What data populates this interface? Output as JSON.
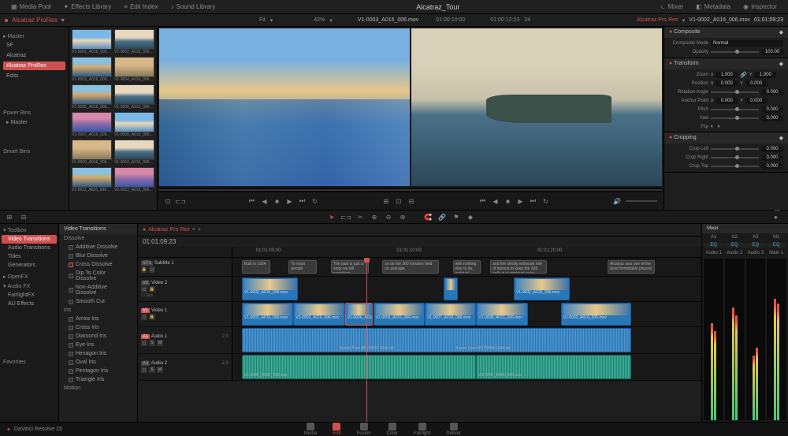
{
  "project_title": "Alcatraz_Tour",
  "top_tabs": {
    "media_pool": "Media Pool",
    "effects": "Effects Library",
    "edit_index": "Edit Index",
    "sound": "Sound Library",
    "mixer": "Mixer",
    "metadata": "Metadata",
    "inspector": "Inspector"
  },
  "sub_bar": {
    "left_label": "Alcatraz ProRes",
    "fit": "Fit",
    "zoom_pct": "42%",
    "src_name": "V1-0003_A016_006.mov",
    "src_tc": "01:00:10:00",
    "dur": "01:00:12:23",
    "fps": "24",
    "right_label": "Alcatraz Pro Rez",
    "right_name": "V1-0002_A016_006.mov",
    "right_tc": "01:01:09:23"
  },
  "bins": {
    "master": "Master",
    "items": [
      "SF",
      "Alcatraz",
      "Alcatraz ProRes",
      "Edits"
    ],
    "sel": 2,
    "power": "Power Bins",
    "pb": "Master",
    "smart": "Smart Bins"
  },
  "thumbs": [
    "V1-0001_A016_006...",
    "V1-0002_A016_006...",
    "V1-0003_A016_006...",
    "V1-0004_A016_006...",
    "V1-0005_A016_006...",
    "V1-0006_A016_006...",
    "V1-0007_A016_006...",
    "V1-0008_A016_006...",
    "V1-0009_A016_006...",
    "V1-0010_A016_006...",
    "V1-0011_A016_006...",
    "V1-0012_A016_006..."
  ],
  "inspector": {
    "composite": {
      "hdr": "Composite",
      "mode_lbl": "Composite Mode",
      "mode": "Normal",
      "opacity_lbl": "Opacity",
      "opacity": "100.00"
    },
    "transform": {
      "hdr": "Transform",
      "zoom_lbl": "Zoom",
      "zoom_x": "1.000",
      "zoom_y": "1.000",
      "pos_lbl": "Position",
      "pos_x": "0.000",
      "pos_y": "0.000",
      "rot_lbl": "Rotation Angle",
      "rot": "0.000",
      "anchor_lbl": "Anchor Point",
      "anch_x": "0.000",
      "anch_y": "0.000",
      "pitch_lbl": "Pitch",
      "pitch": "0.000",
      "yaw_lbl": "Yaw",
      "yaw": "0.000",
      "flip_lbl": "Flip"
    },
    "cropping": {
      "hdr": "Cropping",
      "left_lbl": "Crop Left",
      "left": "0.000",
      "right_lbl": "Crop Right",
      "right": "0.000",
      "top_lbl": "Crop Top",
      "top": "0.000"
    }
  },
  "fx_cats": {
    "toolbox": "Toolbox",
    "items": [
      "Video Transitions",
      "Audio Transitions",
      "Titles",
      "Generators"
    ],
    "openfx": "OpenFX",
    "audiofx": "Audio FX",
    "afx_items": [
      "FairlightFX",
      "AU Effects"
    ],
    "favorites": "Favorites"
  },
  "fx_list": {
    "hdr": "Video Transitions",
    "dissolve": "Dissolve",
    "d_items": [
      "Additive Dissolve",
      "Blur Dissolve",
      "Cross Dissolve",
      "Dip To Color Dissolve",
      "Non-Additive Dissolve",
      "Smooth Cut"
    ],
    "iris": "Iris",
    "i_items": [
      "Arrow Iris",
      "Cross Iris",
      "Diamond Iris",
      "Eye Iris",
      "Hexagon Iris",
      "Oval Iris",
      "Pentagon Iris",
      "Triangle Iris"
    ],
    "motion": "Motion"
  },
  "timeline": {
    "tab": "Alcatraz Pro Rez",
    "tc": "01:01:09:23",
    "ruler": [
      "01:01:00:00",
      "01:01:10:00",
      "01:01:20:00"
    ],
    "tracks": {
      "st1": {
        "tag": "ST1",
        "name": "Subtitle 1"
      },
      "v2": {
        "tag": "V2",
        "name": "Video 2",
        "clips": "3 Clips"
      },
      "v1": {
        "tag": "V1",
        "name": "Video 1"
      },
      "a1": {
        "tag": "A1",
        "name": "Audio 1",
        "fmt": "2.0"
      },
      "a2": {
        "tag": "A2",
        "name": "Audio 2",
        "fmt": "2.0"
      }
    },
    "subs": [
      "Built in 1934",
      "To most people",
      "The past is just a story we tell ourselves",
      "so do the 200 inmates held on average,",
      "with nothing else to do, isolated",
      "and the strictly enforced rule of silence to keep the 336 cells in a constant eerie,",
      "Alcatraz was one of the most formidable prisons"
    ],
    "clip_name": "V1-0002_A016_006.mov",
    "clip_alt1": "V1-0005_A016_006.mov",
    "clip_alt2": "V1-0007_A016_006.mov",
    "clip_alt3": "V1-0008_A016_006.mov",
    "clip_alt4": "V1-0006_A016_006.mov",
    "aud1": "Stress Free 20170810 1346.aif",
    "aud2": "Stress Free 20170810 1346.aif",
    "aud_clip": "V1-0006_A016_006.wav"
  },
  "mixer": {
    "hdr": "Mixer",
    "ch": [
      "A1",
      "A2",
      "A3",
      "M1"
    ],
    "eq": "EQ",
    "names": [
      "Audio 1",
      "Audio 2",
      "Audio 3",
      "Main 1"
    ]
  },
  "bottom": {
    "app": "DaVinci Resolve 15",
    "pages": [
      "Media",
      "Edit",
      "Fusion",
      "Color",
      "Fairlight",
      "Deliver"
    ],
    "sel": 1
  }
}
